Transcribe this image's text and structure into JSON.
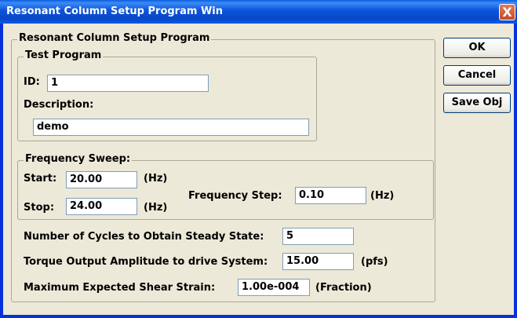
{
  "window": {
    "title": "Resonant Column Setup Program Win",
    "close_glyph": "X"
  },
  "main_group": {
    "label": "Resonant Column Setup Program"
  },
  "test_program": {
    "label": "Test Program",
    "id_label": "ID:",
    "id_value": "1",
    "description_label": "Description:",
    "description_value": "demo"
  },
  "frequency_sweep": {
    "label": "Frequency Sweep:",
    "start_label": "Start:",
    "start_value": "20.00",
    "start_unit": "(Hz)",
    "stop_label": "Stop:",
    "stop_value": "24.00",
    "stop_unit": "(Hz)",
    "step_label": "Frequency Step:",
    "step_value": "0.10",
    "step_unit": "(Hz)"
  },
  "parameters": {
    "cycles_label": "Number of Cycles to Obtain Steady State:",
    "cycles_value": "5",
    "torque_label": "Torque Output Amplitude to drive System:",
    "torque_value": "15.00",
    "torque_unit": "(pfs)",
    "strain_label": "Maximum Expected Shear Strain:",
    "strain_value": "1.00e-004",
    "strain_unit": "(Fraction)"
  },
  "buttons": {
    "ok": "OK",
    "cancel": "Cancel",
    "save": "Save Obj"
  }
}
